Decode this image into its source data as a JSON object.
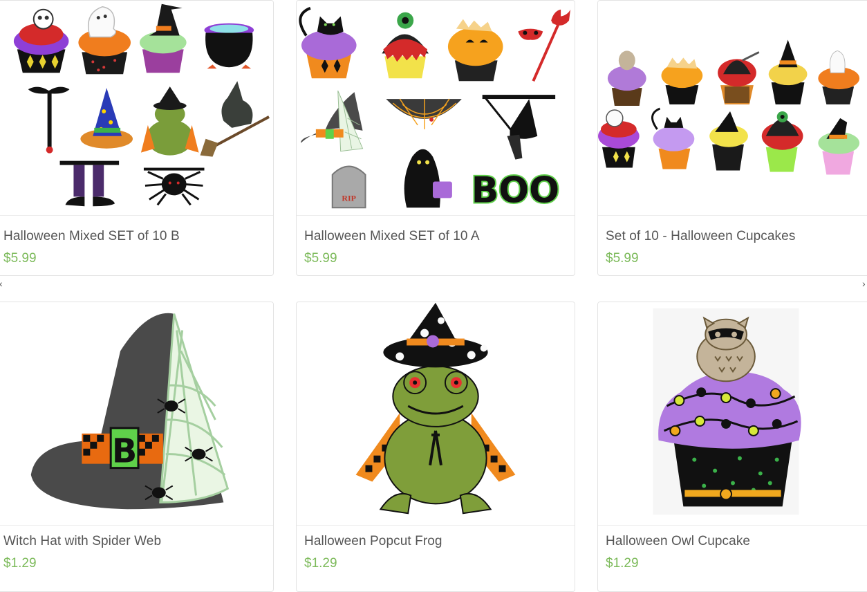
{
  "products": [
    {
      "title": "Halloween Mixed SET of 10 B",
      "price": "$5.99",
      "image_icon": "halloween-mixed-set-b-image"
    },
    {
      "title": "Halloween Mixed SET of 10 A",
      "price": "$5.99",
      "image_icon": "halloween-mixed-set-a-image"
    },
    {
      "title": "Set of 10 - Halloween Cupcakes",
      "price": "$5.99",
      "image_icon": "halloween-cupcakes-set-image"
    },
    {
      "title": "Witch Hat with Spider Web",
      "price": "$1.29",
      "image_icon": "witch-hat-spider-web-image"
    },
    {
      "title": "Halloween Popcut Frog",
      "price": "$1.29",
      "image_icon": "popcut-frog-image"
    },
    {
      "title": "Halloween Owl Cupcake",
      "price": "$1.29",
      "image_icon": "owl-cupcake-image"
    }
  ],
  "image_text": {
    "rip": "RIP",
    "boo": "BOO",
    "hat_letter": "B"
  },
  "colors": {
    "price": "#7cba5a",
    "title": "#555555",
    "border": "#e3e3e3"
  },
  "carousel": {
    "prev_icon": "chevron-left-icon",
    "next_icon": "chevron-right-icon"
  }
}
